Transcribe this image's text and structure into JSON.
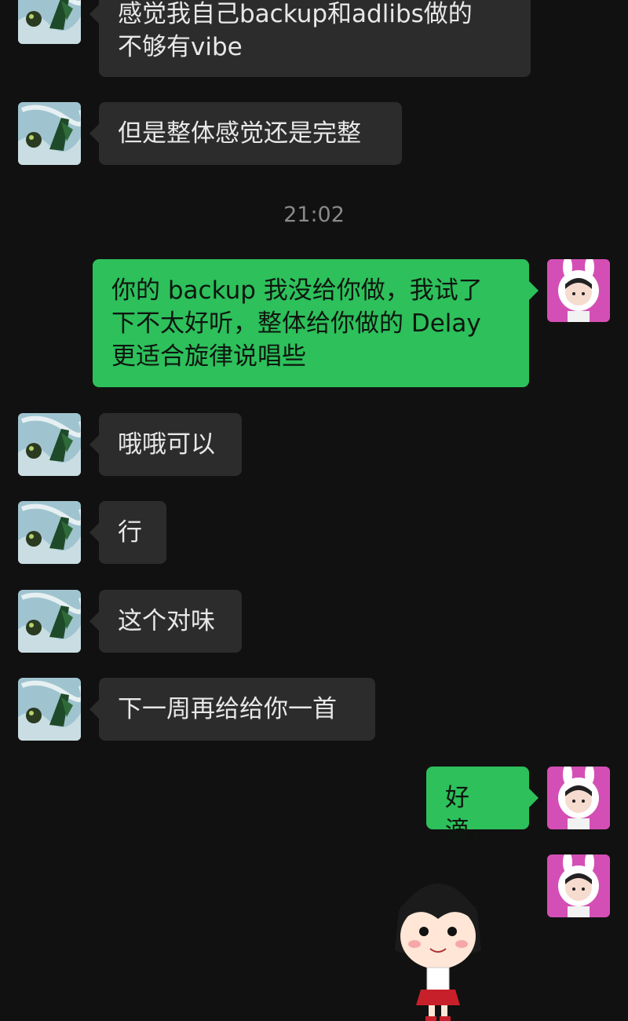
{
  "messages": [
    {
      "from": "other",
      "text": "感觉我自己backup和adlibs做的\n不够有vibe"
    },
    {
      "from": "other",
      "text": "但是整体感觉还是完整"
    },
    {
      "from": "me",
      "text": "你的 backup 我没给你做，我试了\n下不太好听，整体给你做的 Delay\n更适合旋律说唱些"
    },
    {
      "from": "other",
      "text": "哦哦可以"
    },
    {
      "from": "other",
      "text": "行"
    },
    {
      "from": "other",
      "text": "这个对味"
    },
    {
      "from": "other",
      "text": "下一周再给给你一首"
    },
    {
      "from": "me",
      "text": "好滴，"
    },
    {
      "from": "me",
      "type": "sticker",
      "icon": "cartoon-girl-sticker"
    }
  ],
  "timestamp": "21:02",
  "colors": {
    "background": "#111111",
    "incoming_bubble": "#2c2c2c",
    "outgoing_bubble": "#2dc05b"
  },
  "icons": {
    "other_avatar": "green-figure-avatar",
    "my_avatar": "bunny-hood-girl-avatar"
  }
}
